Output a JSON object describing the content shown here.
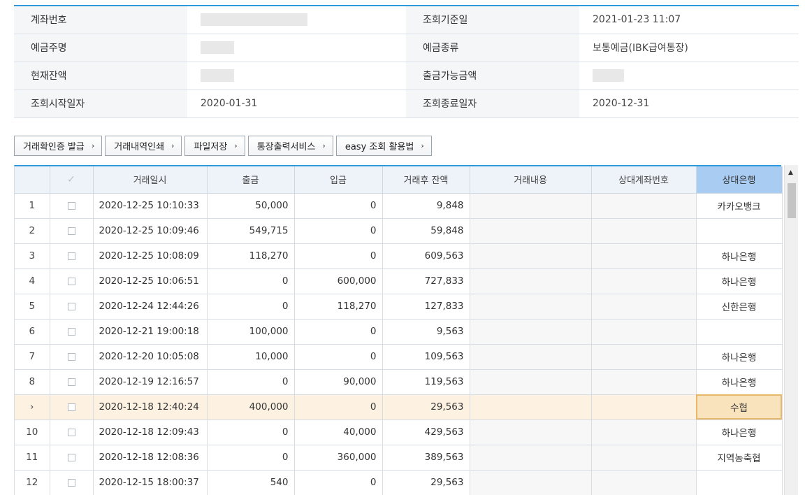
{
  "info": {
    "rows": [
      {
        "label1": "계좌번호",
        "value1": "",
        "label2": "조회기준일",
        "value2": "2021-01-23 11:07"
      },
      {
        "label1": "예금주명",
        "value1": "",
        "label2": "예금종류",
        "value2": "보통예금(IBK급여통장)"
      },
      {
        "label1": "현재잔액",
        "value1": "",
        "label2": "출금가능금액",
        "value2": ""
      },
      {
        "label1": "조회시작일자",
        "value1": "2020-01-31",
        "label2": "조회종료일자",
        "value2": "2020-12-31"
      }
    ]
  },
  "buttons": {
    "confirm": "거래확인증 발급",
    "print": "거래내역인쇄",
    "save": "파일저장",
    "passbook": "통장출력서비스",
    "easy": "easy 조회 활용법"
  },
  "grid": {
    "headers": {
      "check": "✓",
      "datetime": "거래일시",
      "withdraw": "출금",
      "deposit": "입금",
      "balance": "거래후 잔액",
      "content": "거래내용",
      "counter_account": "상대계좌번호",
      "counter_bank": "상대은행"
    },
    "rows": [
      {
        "no": "1",
        "datetime": "2020-12-25 10:10:33",
        "withdraw": "50,000",
        "deposit": "0",
        "balance": "9,848",
        "bank": "카카오뱅크"
      },
      {
        "no": "2",
        "datetime": "2020-12-25 10:09:46",
        "withdraw": "549,715",
        "deposit": "0",
        "balance": "59,848",
        "bank": ""
      },
      {
        "no": "3",
        "datetime": "2020-12-25 10:08:09",
        "withdraw": "118,270",
        "deposit": "0",
        "balance": "609,563",
        "bank": "하나은행"
      },
      {
        "no": "4",
        "datetime": "2020-12-25 10:06:51",
        "withdraw": "0",
        "deposit": "600,000",
        "balance": "727,833",
        "bank": "하나은행"
      },
      {
        "no": "5",
        "datetime": "2020-12-24 12:44:26",
        "withdraw": "0",
        "deposit": "118,270",
        "balance": "127,833",
        "bank": "신한은행"
      },
      {
        "no": "6",
        "datetime": "2020-12-21 19:00:18",
        "withdraw": "100,000",
        "deposit": "0",
        "balance": "9,563",
        "bank": ""
      },
      {
        "no": "7",
        "datetime": "2020-12-20 10:05:08",
        "withdraw": "10,000",
        "deposit": "0",
        "balance": "109,563",
        "bank": "하나은행"
      },
      {
        "no": "8",
        "datetime": "2020-12-19 12:16:57",
        "withdraw": "0",
        "deposit": "90,000",
        "balance": "119,563",
        "bank": "하나은행"
      },
      {
        "no": "›",
        "datetime": "2020-12-18 12:40:24",
        "withdraw": "400,000",
        "deposit": "0",
        "balance": "29,563",
        "bank": "수협"
      },
      {
        "no": "10",
        "datetime": "2020-12-18 12:09:43",
        "withdraw": "0",
        "deposit": "40,000",
        "balance": "429,563",
        "bank": "하나은행"
      },
      {
        "no": "11",
        "datetime": "2020-12-18 12:08:36",
        "withdraw": "0",
        "deposit": "360,000",
        "balance": "389,563",
        "bank": "지역농축협"
      },
      {
        "no": "12",
        "datetime": "2020-12-15 18:00:37",
        "withdraw": "540",
        "deposit": "0",
        "balance": "29,563",
        "bank": ""
      }
    ]
  }
}
